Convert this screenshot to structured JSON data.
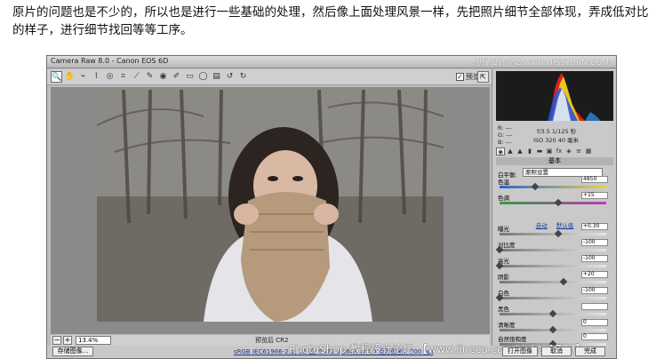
{
  "intro_text": "原片的问题也是不少的，所以也是进行一些基础的处理，然后像上面处理风景一样，先把照片细节全部体现，弄成低对比的样子，进行细节找回等等工序。",
  "window": {
    "title": "Camera Raw 8.0 -  Canon EOS 6D",
    "watermark": "思缘设计论坛 www.MISSYUAN.COM"
  },
  "toolbar": {
    "tools": [
      {
        "name": "zoom-tool-icon",
        "glyph": "🔍"
      },
      {
        "name": "hand-tool-icon",
        "glyph": "✋"
      },
      {
        "name": "white-balance-tool-icon",
        "glyph": "⌁"
      },
      {
        "name": "color-sampler-tool-icon",
        "glyph": "⌇"
      },
      {
        "name": "target-adjust-tool-icon",
        "glyph": "◎"
      },
      {
        "name": "crop-tool-icon",
        "glyph": "⌗"
      },
      {
        "name": "straighten-tool-icon",
        "glyph": "⟋"
      },
      {
        "name": "spot-removal-tool-icon",
        "glyph": "✎"
      },
      {
        "name": "red-eye-tool-icon",
        "glyph": "◉"
      },
      {
        "name": "adjustment-brush-icon",
        "glyph": "✐"
      },
      {
        "name": "graduated-filter-icon",
        "glyph": "▭"
      },
      {
        "name": "radial-filter-icon",
        "glyph": "◯"
      },
      {
        "name": "preferences-icon",
        "glyph": "▤"
      },
      {
        "name": "rotate-left-icon",
        "glyph": "↺"
      },
      {
        "name": "rotate-right-icon",
        "glyph": "↻"
      }
    ],
    "preview_label": "预览",
    "preview_checked": "✓"
  },
  "status": {
    "zoom_value": "13.4%",
    "filename": "预览后 CR2"
  },
  "bottom": {
    "save_label": "存储图像...",
    "workflow_text": "sRGB IEC61966-2.1; 16 位; 5472 x 3648 (20.0 百万像素); 300 ppi",
    "watermark": "PhotoShop 教程设计论坛 【www.lineca.com/tieba/1783】",
    "open_label": "打开图像",
    "cancel_label": "取消",
    "done_label": "完成"
  },
  "panel": {
    "rgb_r": "R:  ---",
    "rgb_g": "G:  ---",
    "rgb_b": "B:  ---",
    "exif_line1": "f/3.5   1/125 秒",
    "exif_line2": "ISO 320   40 毫米",
    "section_title": "基本",
    "wb_label": "白平衡:",
    "wb_value": "原照设置",
    "auto_label": "自动",
    "default_label": "默认值",
    "sliders": [
      {
        "name": "temperature",
        "label": "色温",
        "value": "4850",
        "pos": 0.33
      },
      {
        "name": "tint",
        "label": "色调",
        "value": "+15",
        "pos": 0.55
      },
      {
        "name": "exposure",
        "label": "曝光",
        "value": "+0.30",
        "pos": 0.55
      },
      {
        "name": "contrast",
        "label": "对比度",
        "value": "-100",
        "pos": 0.0
      },
      {
        "name": "highlights",
        "label": "高光",
        "value": "-100",
        "pos": 0.0
      },
      {
        "name": "shadows",
        "label": "阴影",
        "value": "+20",
        "pos": 0.6
      },
      {
        "name": "whites",
        "label": "白色",
        "value": "-100",
        "pos": 0.0
      },
      {
        "name": "blacks",
        "label": "黑色",
        "value": "",
        "pos": 0.5
      },
      {
        "name": "clarity",
        "label": "清晰度",
        "value": "0",
        "pos": 0.5
      },
      {
        "name": "vibrance",
        "label": "自然饱和度",
        "value": "0",
        "pos": 0.5
      }
    ]
  }
}
